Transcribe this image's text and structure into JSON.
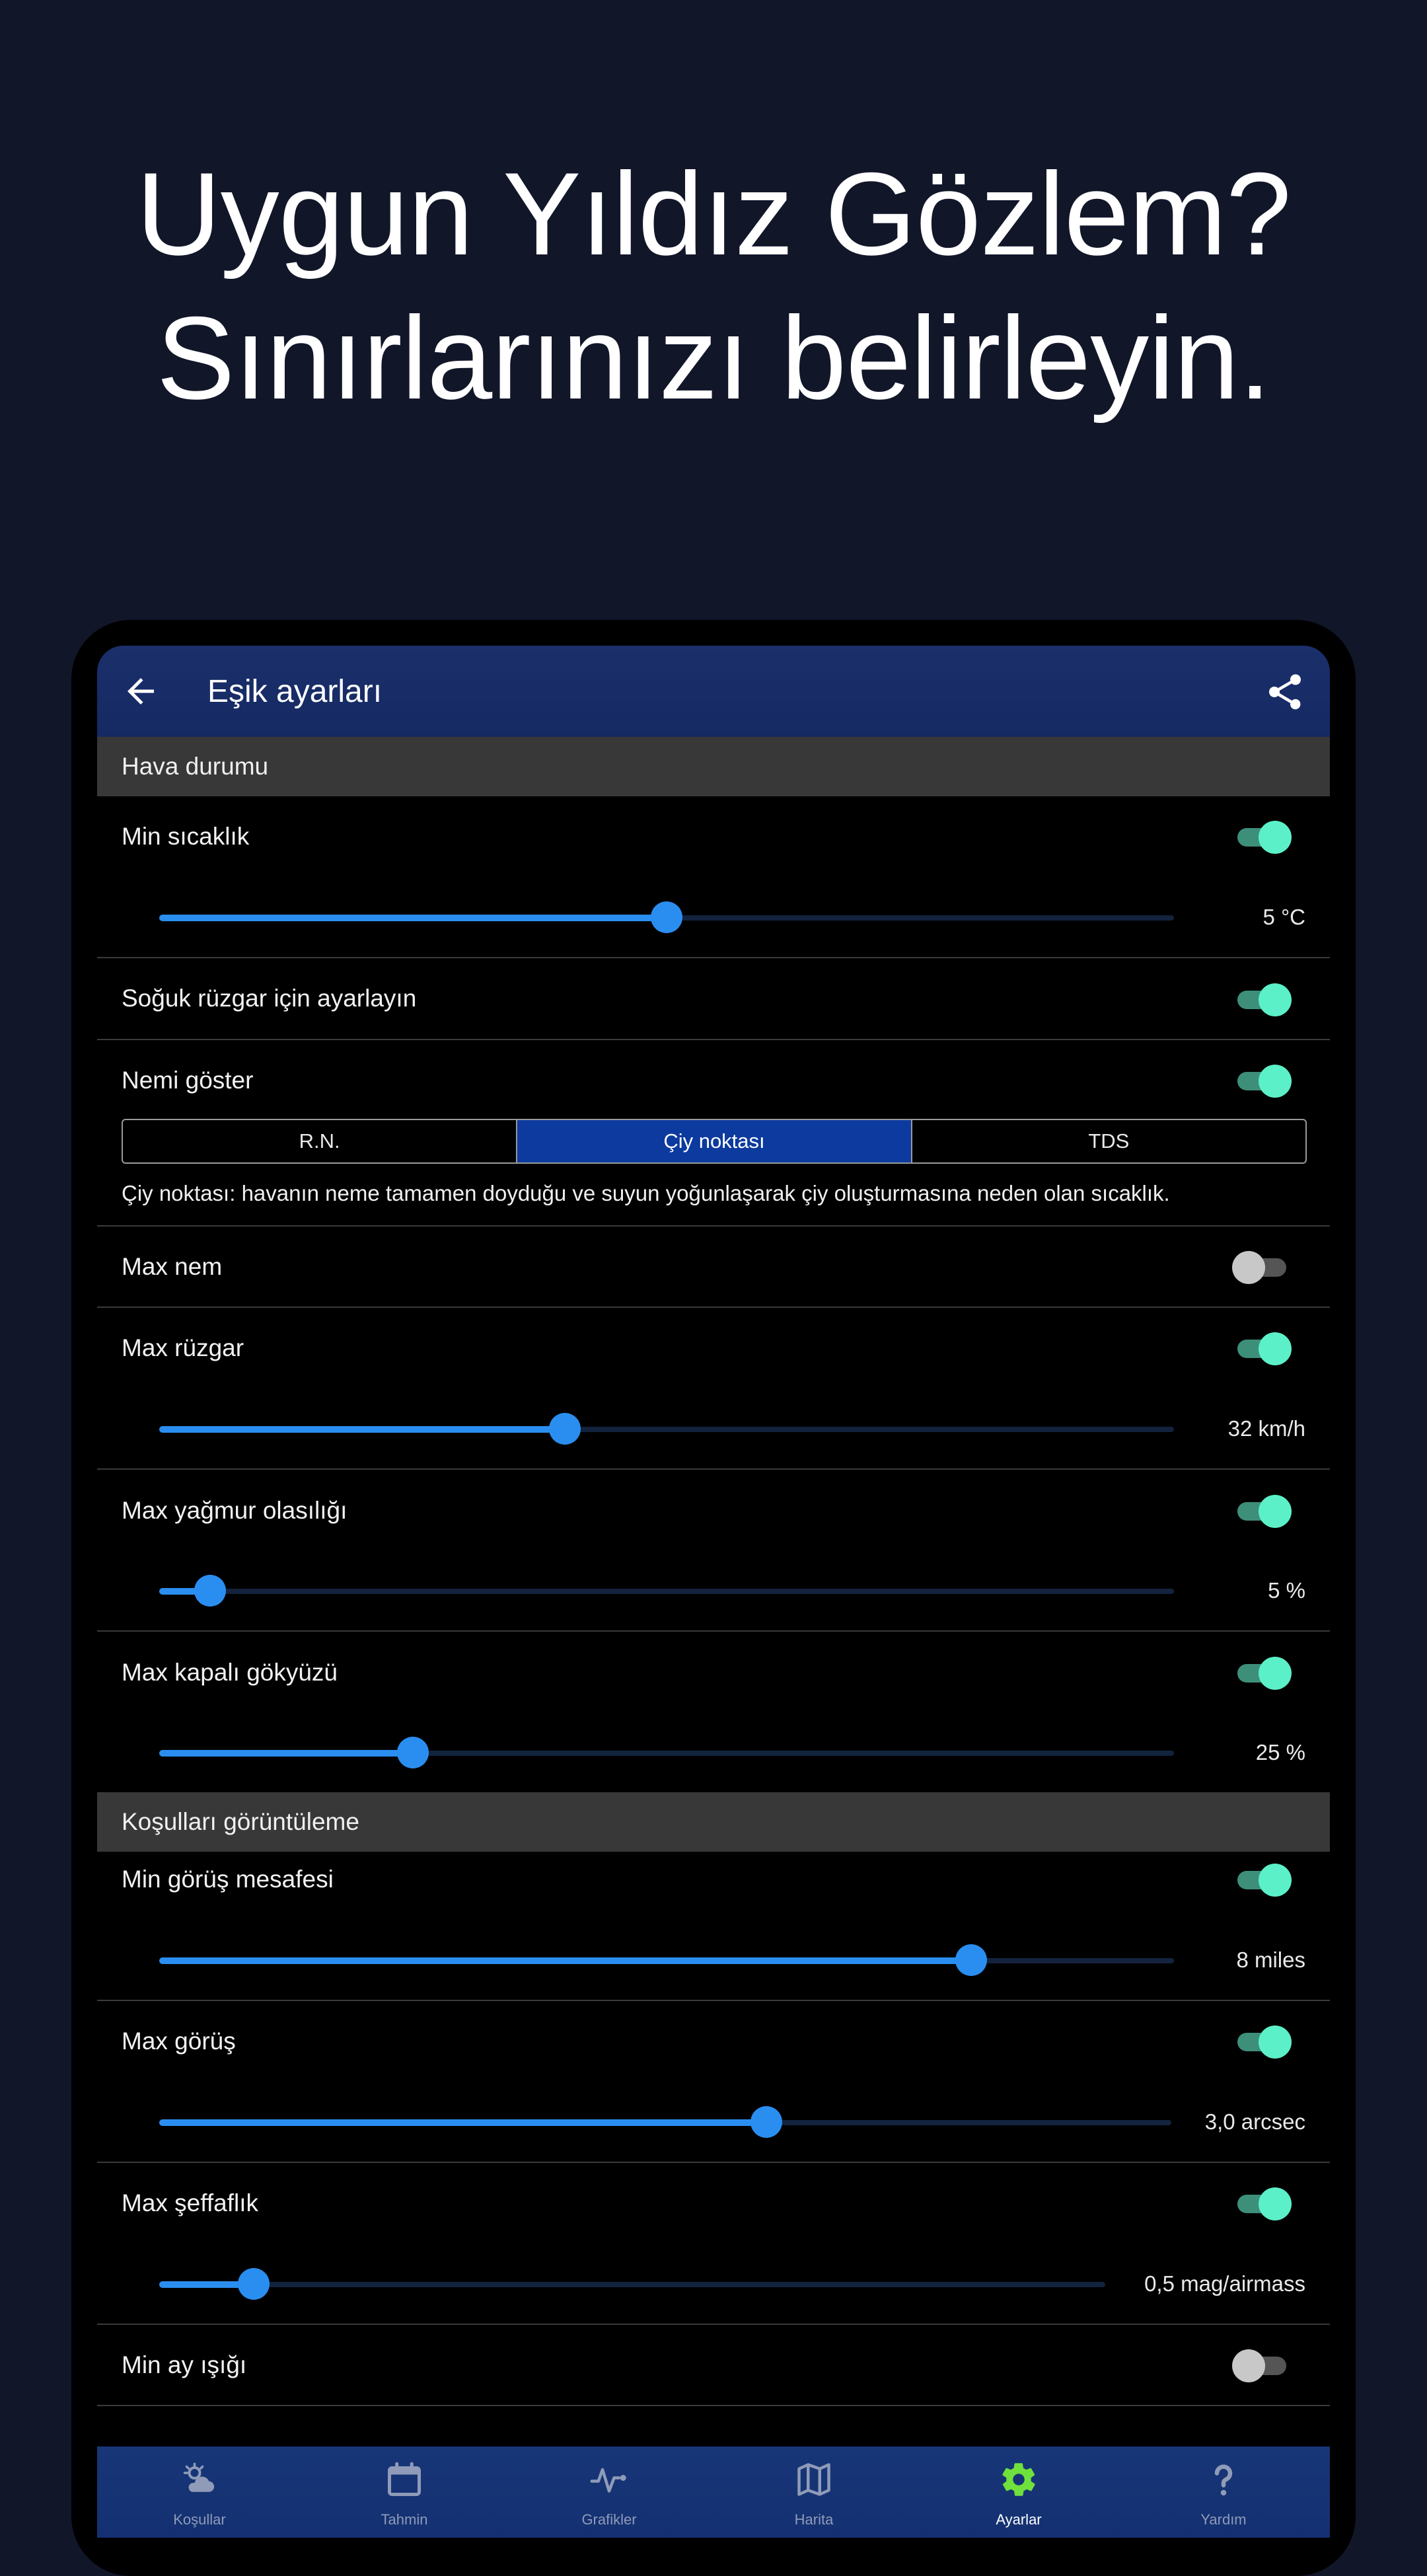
{
  "headline": {
    "line1": "Uygun Yıldız Gözlem?",
    "line2": "Sınırlarınızı belirleyin."
  },
  "appbar": {
    "back_icon": "arrow-left-icon",
    "title": "Eşik ayarları",
    "share_icon": "share-icon"
  },
  "sections": {
    "weather": "Hava durumu",
    "display": "Koşulları görüntüleme"
  },
  "settings": {
    "min_temp": {
      "label": "Min sıcaklık",
      "enabled": true,
      "value": "5 °C",
      "fraction": 0.5
    },
    "wind_chill": {
      "label": "Soğuk rüzgar için ayarlayın",
      "enabled": true
    },
    "humidity": {
      "label": "Nemi göster",
      "enabled": true,
      "options": [
        "R.N.",
        "Çiy noktası",
        "TDS"
      ],
      "selected": "Çiy noktası",
      "description": "Çiy noktası: havanın neme tamamen doyduğu ve suyun yoğunlaşarak çiy oluşturmasına neden olan sıcaklık."
    },
    "max_humidity": {
      "label": "Max nem",
      "enabled": false
    },
    "max_wind": {
      "label": "Max rüzgar",
      "enabled": true,
      "value": "32 km/h",
      "fraction": 0.4
    },
    "max_rain": {
      "label": "Max yağmur olasılığı",
      "enabled": true,
      "value": "5 %",
      "fraction": 0.05
    },
    "max_cloud": {
      "label": "Max kapalı gökyüzü",
      "enabled": true,
      "value": "25 %",
      "fraction": 0.25
    },
    "min_visibility": {
      "label": "Min görüş mesafesi",
      "enabled": true,
      "value": "8 miles",
      "fraction": 0.8
    },
    "max_seeing": {
      "label": "Max görüş",
      "enabled": true,
      "value": "3,0 arcsec",
      "fraction": 0.6
    },
    "max_transparency": {
      "label": "Max şeffaflık",
      "enabled": true,
      "value": "0,5 mag/airmass",
      "fraction": 0.1
    },
    "min_moonlight": {
      "label": "Min ay ışığı",
      "enabled": false
    }
  },
  "nav": [
    {
      "label": "Koşullar",
      "icon": "partly-cloudy-icon"
    },
    {
      "label": "Tahmin",
      "icon": "calendar-icon"
    },
    {
      "label": "Grafikler",
      "icon": "pulse-chart-icon"
    },
    {
      "label": "Harita",
      "icon": "map-icon"
    },
    {
      "label": "Ayarlar",
      "icon": "gear-icon",
      "active": true
    },
    {
      "label": "Yardım",
      "icon": "question-icon"
    }
  ],
  "colors": {
    "background": "#121629",
    "accent": "#2a8ef0",
    "toggle_on": "#5cf0c8",
    "active_nav_icon": "#6fe03c",
    "appbar": "#1b2f6b"
  }
}
